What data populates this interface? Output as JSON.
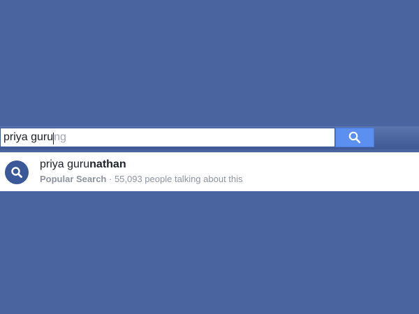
{
  "search": {
    "typed_text": "priya guru",
    "suggestion_completion": "ng",
    "button_icon": "search-icon"
  },
  "results": [
    {
      "title_prefix": "priya guru",
      "title_match": "nathan",
      "category": "Popular Search",
      "separator": " · ",
      "detail": "55,093 people talking about this",
      "icon": "search-icon"
    }
  ],
  "colors": {
    "background": "#4a64a0",
    "button": "#5b8ff0",
    "icon_circle": "#3b5998"
  }
}
